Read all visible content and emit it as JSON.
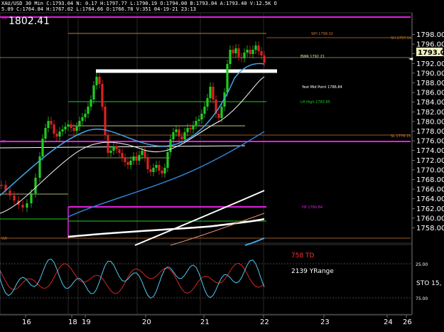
{
  "header": {
    "line1": "XAU/USD 30 Min  C:1793.04  N: 0.17  H:1797.77  L:1790.19  O:1794.00  B:1793.04  A:1793.40  V:12.5K  O",
    "line2": "5.09  C:1764.84  H:1767.02  L:1764.66  O:1766.78  V:351  04-19-21  23:13",
    "big_price": "1802.41"
  },
  "price_axis": {
    "labels": [
      "1798.00",
      "1796.00",
      "1794.00",
      "1792.00",
      "1790.00",
      "1788.00",
      "1786.00",
      "1784.00",
      "1782.00",
      "1780.00",
      "1778.00",
      "1776.00",
      "1774.00",
      "1772.00",
      "1770.00",
      "1768.00",
      "1766.00",
      "1764.00",
      "1762.00",
      "1760.00",
      "1758.00"
    ],
    "current_price": "1793.04"
  },
  "annotations": {
    "wh": "WH 1798.32",
    "swh": "SH 1797.54",
    "bwr": "BWR 1792.21",
    "yest_mid": "Yest Mid Point 1786.84",
    "lh_high": "LH High 1783.65",
    "sl": "SL 1776.15",
    "hp": "HP 1760.84",
    "left_top": "WR",
    "left_mid": "FP",
    "left_bot": "SW"
  },
  "indicator": {
    "td_label": "758 TD",
    "yrange_label": "2139 YRange",
    "level_25": "25.00",
    "level_75": "75.00",
    "sto_label": "STO 15,"
  },
  "date_axis": {
    "labels": [
      "16",
      "18",
      "19",
      "20",
      "21",
      "22",
      "23",
      "24",
      "26"
    ]
  },
  "colors": {
    "magenta": "#e020e0",
    "orange": "#c87830",
    "green": "#22cc22",
    "white": "#ffffff",
    "cyan": "#30a0e0",
    "price_box": "#f0f0c0",
    "td_red": "#ff3030"
  }
}
